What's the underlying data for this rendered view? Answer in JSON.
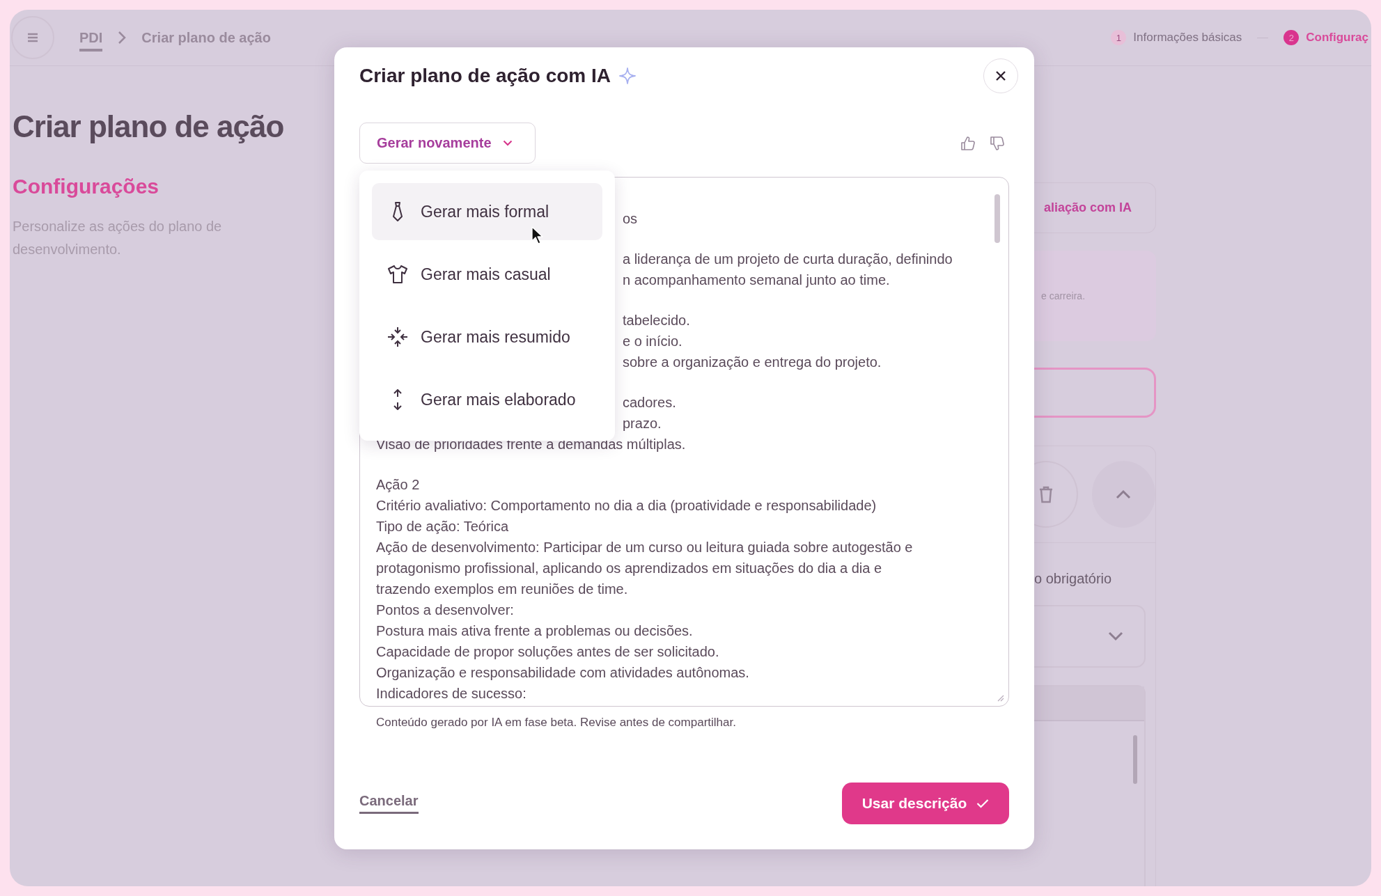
{
  "background_page": {
    "breadcrumb": [
      {
        "label": "PDI",
        "kind": "link"
      },
      {
        "label": "Criar plano de ação",
        "kind": "current"
      }
    ],
    "stepper": [
      {
        "number": "1",
        "label": "Informações básicas",
        "selected": false
      },
      {
        "number": "2",
        "label": "Configuraç",
        "selected": true
      }
    ],
    "title": "Criar plano de ação",
    "section_title": "Configurações",
    "section_description": "Personalize as ações do plano de desenvolvimento.",
    "side_panel": {
      "ai_button": "aliação com IA",
      "info_text": "e carreira.",
      "field_label": "o obrigatório"
    }
  },
  "modal": {
    "title": "Criar plano de ação com IA",
    "regenerate_button": "Gerar novamente",
    "menu": [
      {
        "label": "Gerar mais formal",
        "kind": "formal",
        "highlighted": true
      },
      {
        "label": "Gerar mais casual",
        "kind": "casual",
        "highlighted": false
      },
      {
        "label": "Gerar mais resumido",
        "kind": "shorter",
        "highlighted": false
      },
      {
        "label": "Gerar mais elaborado",
        "kind": "longer",
        "highlighted": false
      }
    ],
    "description_blocks": [
      [
        {
          "text": "os",
          "kind": "partial"
        }
      ],
      [
        {
          "text": "a liderança de um projeto de curta duração, definindo",
          "kind": "partial"
        },
        {
          "text": "n acompanhamento semanal junto ao time.",
          "kind": "partial"
        }
      ],
      [
        {
          "text": "tabelecido.",
          "kind": "partial"
        },
        {
          "text": "e o início.",
          "kind": "partial"
        },
        {
          "text": "sobre a organização e entrega do projeto.",
          "kind": "partial"
        }
      ],
      [
        {
          "text": "cadores.",
          "kind": "partial"
        },
        {
          "text": "prazo.",
          "kind": "partial"
        },
        {
          "text": "Visão de prioridades frente a demandas múltiplas.",
          "kind": "full"
        }
      ],
      [
        {
          "text": "Ação 2",
          "kind": "full"
        },
        {
          "text": "Critério avaliativo: Comportamento no dia a dia (proatividade e responsabilidade)",
          "kind": "full"
        },
        {
          "text": "Tipo de ação: Teórica",
          "kind": "full"
        },
        {
          "text": "Ação de desenvolvimento: Participar de um curso ou leitura guiada sobre autogestão e",
          "kind": "full"
        },
        {
          "text": "protagonismo profissional, aplicando os aprendizados em situações do dia a dia e",
          "kind": "full"
        },
        {
          "text": "trazendo exemplos em reuniões de time.",
          "kind": "full"
        },
        {
          "text": "Pontos a desenvolver:",
          "kind": "full"
        },
        {
          "text": "Postura mais ativa frente a problemas ou decisões.",
          "kind": "full"
        },
        {
          "text": "Capacidade de propor soluções antes de ser solicitado.",
          "kind": "full"
        },
        {
          "text": "Organização e responsabilidade com atividades autônomas.",
          "kind": "full"
        },
        {
          "text": "Indicadores de sucesso:",
          "kind": "full"
        }
      ]
    ],
    "disclaimer": "Conteúdo gerado por IA em fase beta. Revise antes de compartilhar.",
    "cancel_link": "Cancelar",
    "confirm_button": "Usar descrição"
  }
}
